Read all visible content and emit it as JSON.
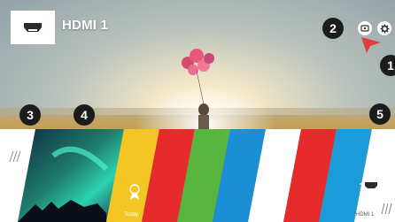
{
  "input": {
    "title": "HDMI 1",
    "icon": "hdmi-port-icon"
  },
  "top_icons": [
    {
      "name": "input-icon"
    },
    {
      "name": "settings-gear-icon"
    }
  ],
  "callouts": [
    "1",
    "2",
    "3",
    "4",
    "5"
  ],
  "launcher": {
    "tiles": [
      {
        "name": "recent-handle",
        "color": "#ffffff"
      },
      {
        "name": "aurora-preview",
        "color": "#1c4a66"
      },
      {
        "name": "today",
        "label": "Today",
        "color": "#f3c623"
      },
      {
        "name": "app-red",
        "color": "#e52b2b"
      },
      {
        "name": "app-green",
        "color": "#58b53d"
      },
      {
        "name": "app-blue",
        "color": "#1b8ed6"
      },
      {
        "name": "app-white",
        "color": "#ffffff"
      },
      {
        "name": "app-red-2",
        "color": "#e52b2b"
      },
      {
        "name": "app-blue-2",
        "color": "#1b9bd8"
      },
      {
        "name": "antenna",
        "color": "#f3c623",
        "icon": "antenna-icon"
      },
      {
        "name": "hdmi1",
        "label": "HDMI 1",
        "color": "#ffffff",
        "icon": "hdmi-port-icon"
      },
      {
        "name": "more",
        "color": "#ffffff"
      }
    ]
  }
}
